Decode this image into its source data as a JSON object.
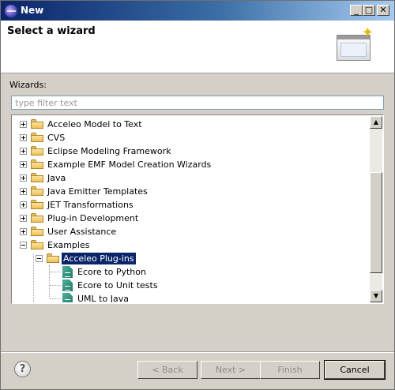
{
  "window": {
    "title": "New"
  },
  "titlebar_buttons": {
    "minimize": "_",
    "maximize": "□",
    "close": "✕"
  },
  "banner": {
    "title": "Select a wizard",
    "icon": "new-wizard-icon"
  },
  "wizards": {
    "label": "Wizards:",
    "filter_placeholder": "type filter text",
    "tree": [
      {
        "label": "Acceleo Model to Text",
        "type": "folder",
        "expanded": false
      },
      {
        "label": "CVS",
        "type": "folder",
        "expanded": false
      },
      {
        "label": "Eclipse Modeling Framework",
        "type": "folder",
        "expanded": false
      },
      {
        "label": "Example EMF Model Creation Wizards",
        "type": "folder",
        "expanded": false
      },
      {
        "label": "Java",
        "type": "folder",
        "expanded": false
      },
      {
        "label": "Java Emitter Templates",
        "type": "folder",
        "expanded": false
      },
      {
        "label": "JET Transformations",
        "type": "folder",
        "expanded": false
      },
      {
        "label": "Plug-in Development",
        "type": "folder",
        "expanded": false
      },
      {
        "label": "User Assistance",
        "type": "folder",
        "expanded": false
      },
      {
        "label": "Examples",
        "type": "folder",
        "expanded": true
      },
      {
        "label": "Acceleo Plug-ins",
        "type": "folder",
        "expanded": true,
        "selected": true
      },
      {
        "label": "Ecore to Python",
        "type": "file"
      },
      {
        "label": "Ecore to Unit tests",
        "type": "file"
      },
      {
        "label": "UML to Java",
        "type": "file"
      }
    ]
  },
  "scrollbar": {
    "up": "▲",
    "down": "▼"
  },
  "buttons": {
    "help": "?",
    "back": "< Back",
    "next": "Next >",
    "finish": "Finish",
    "cancel": "Cancel"
  }
}
